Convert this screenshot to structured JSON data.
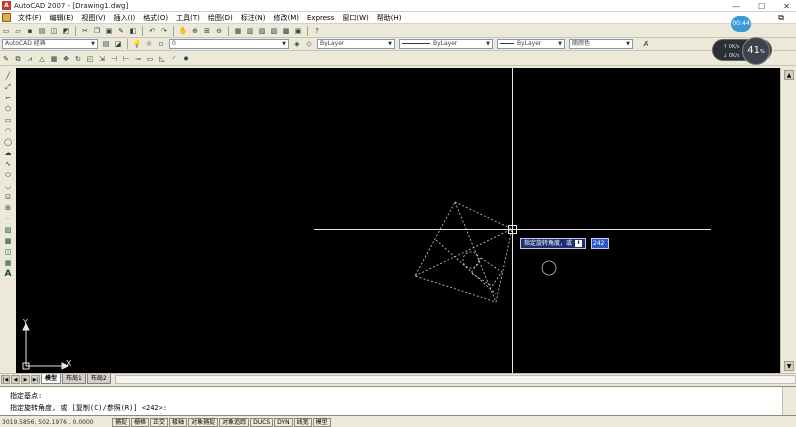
{
  "window": {
    "title": "AutoCAD 2007 - [Drawing1.dwg]",
    "minimize": "—",
    "maximize": "☐",
    "close": "✕"
  },
  "menu": {
    "items": [
      "文件(F)",
      "编辑(E)",
      "视图(V)",
      "插入(I)",
      "格式(O)",
      "工具(T)",
      "绘图(D)",
      "标注(N)",
      "修改(M)",
      "Express",
      "窗口(W)",
      "帮助(H)"
    ],
    "restore": "⧉"
  },
  "toolbar": {
    "workspace": "AutoCAD 经典",
    "layer": "0",
    "color": "ByLayer",
    "linetype": "ByLayer",
    "lineweight": "ByLayer",
    "plotstyle": "随颜色"
  },
  "canvas": {
    "prompt": "指定旋转角度，或",
    "value": "242",
    "ucs_x": "X",
    "ucs_y": "Y"
  },
  "layout_tabs": [
    "模型",
    "布局1",
    "布局2"
  ],
  "command": {
    "line1": "指定基点:",
    "line2": "指定旋转角度, 或 [复制(C)/参照(R)] <242>:"
  },
  "status": {
    "coords": "3019.5856, 502.1976 , 0.0000",
    "buttons": [
      "捕捉",
      "栅格",
      "正交",
      "极轴",
      "对象捕捉",
      "对象追踪",
      "DUCS",
      "DYN",
      "线宽",
      "模型"
    ]
  },
  "overlay": {
    "badge": "00:44",
    "up": "0K/s",
    "down": "0K/s",
    "percent": "41",
    "percent_sign": "%"
  },
  "colors": {
    "canvas": "#000000",
    "crosshair": "#e6e6e6",
    "selection": "#cfcfcf",
    "ui": "#ece9d8"
  }
}
